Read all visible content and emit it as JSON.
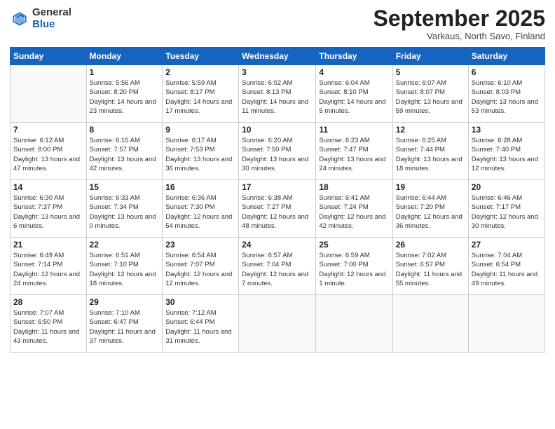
{
  "header": {
    "logo_general": "General",
    "logo_blue": "Blue",
    "title": "September 2025",
    "location": "Varkaus, North Savo, Finland"
  },
  "days_of_week": [
    "Sunday",
    "Monday",
    "Tuesday",
    "Wednesday",
    "Thursday",
    "Friday",
    "Saturday"
  ],
  "weeks": [
    [
      {
        "day": "",
        "sunrise": "",
        "sunset": "",
        "daylight": ""
      },
      {
        "day": "1",
        "sunrise": "Sunrise: 5:56 AM",
        "sunset": "Sunset: 8:20 PM",
        "daylight": "Daylight: 14 hours and 23 minutes."
      },
      {
        "day": "2",
        "sunrise": "Sunrise: 5:59 AM",
        "sunset": "Sunset: 8:17 PM",
        "daylight": "Daylight: 14 hours and 17 minutes."
      },
      {
        "day": "3",
        "sunrise": "Sunrise: 6:02 AM",
        "sunset": "Sunset: 8:13 PM",
        "daylight": "Daylight: 14 hours and 11 minutes."
      },
      {
        "day": "4",
        "sunrise": "Sunrise: 6:04 AM",
        "sunset": "Sunset: 8:10 PM",
        "daylight": "Daylight: 14 hours and 5 minutes."
      },
      {
        "day": "5",
        "sunrise": "Sunrise: 6:07 AM",
        "sunset": "Sunset: 8:07 PM",
        "daylight": "Daylight: 13 hours and 59 minutes."
      },
      {
        "day": "6",
        "sunrise": "Sunrise: 6:10 AM",
        "sunset": "Sunset: 8:03 PM",
        "daylight": "Daylight: 13 hours and 53 minutes."
      }
    ],
    [
      {
        "day": "7",
        "sunrise": "Sunrise: 6:12 AM",
        "sunset": "Sunset: 8:00 PM",
        "daylight": "Daylight: 13 hours and 47 minutes."
      },
      {
        "day": "8",
        "sunrise": "Sunrise: 6:15 AM",
        "sunset": "Sunset: 7:57 PM",
        "daylight": "Daylight: 13 hours and 42 minutes."
      },
      {
        "day": "9",
        "sunrise": "Sunrise: 6:17 AM",
        "sunset": "Sunset: 7:53 PM",
        "daylight": "Daylight: 13 hours and 36 minutes."
      },
      {
        "day": "10",
        "sunrise": "Sunrise: 6:20 AM",
        "sunset": "Sunset: 7:50 PM",
        "daylight": "Daylight: 13 hours and 30 minutes."
      },
      {
        "day": "11",
        "sunrise": "Sunrise: 6:23 AM",
        "sunset": "Sunset: 7:47 PM",
        "daylight": "Daylight: 13 hours and 24 minutes."
      },
      {
        "day": "12",
        "sunrise": "Sunrise: 6:25 AM",
        "sunset": "Sunset: 7:44 PM",
        "daylight": "Daylight: 13 hours and 18 minutes."
      },
      {
        "day": "13",
        "sunrise": "Sunrise: 6:28 AM",
        "sunset": "Sunset: 7:40 PM",
        "daylight": "Daylight: 13 hours and 12 minutes."
      }
    ],
    [
      {
        "day": "14",
        "sunrise": "Sunrise: 6:30 AM",
        "sunset": "Sunset: 7:37 PM",
        "daylight": "Daylight: 13 hours and 6 minutes."
      },
      {
        "day": "15",
        "sunrise": "Sunrise: 6:33 AM",
        "sunset": "Sunset: 7:34 PM",
        "daylight": "Daylight: 13 hours and 0 minutes."
      },
      {
        "day": "16",
        "sunrise": "Sunrise: 6:36 AM",
        "sunset": "Sunset: 7:30 PM",
        "daylight": "Daylight: 12 hours and 54 minutes."
      },
      {
        "day": "17",
        "sunrise": "Sunrise: 6:38 AM",
        "sunset": "Sunset: 7:27 PM",
        "daylight": "Daylight: 12 hours and 48 minutes."
      },
      {
        "day": "18",
        "sunrise": "Sunrise: 6:41 AM",
        "sunset": "Sunset: 7:24 PM",
        "daylight": "Daylight: 12 hours and 42 minutes."
      },
      {
        "day": "19",
        "sunrise": "Sunrise: 6:44 AM",
        "sunset": "Sunset: 7:20 PM",
        "daylight": "Daylight: 12 hours and 36 minutes."
      },
      {
        "day": "20",
        "sunrise": "Sunrise: 6:46 AM",
        "sunset": "Sunset: 7:17 PM",
        "daylight": "Daylight: 12 hours and 30 minutes."
      }
    ],
    [
      {
        "day": "21",
        "sunrise": "Sunrise: 6:49 AM",
        "sunset": "Sunset: 7:14 PM",
        "daylight": "Daylight: 12 hours and 24 minutes."
      },
      {
        "day": "22",
        "sunrise": "Sunrise: 6:51 AM",
        "sunset": "Sunset: 7:10 PM",
        "daylight": "Daylight: 12 hours and 18 minutes."
      },
      {
        "day": "23",
        "sunrise": "Sunrise: 6:54 AM",
        "sunset": "Sunset: 7:07 PM",
        "daylight": "Daylight: 12 hours and 12 minutes."
      },
      {
        "day": "24",
        "sunrise": "Sunrise: 6:57 AM",
        "sunset": "Sunset: 7:04 PM",
        "daylight": "Daylight: 12 hours and 7 minutes."
      },
      {
        "day": "25",
        "sunrise": "Sunrise: 6:59 AM",
        "sunset": "Sunset: 7:00 PM",
        "daylight": "Daylight: 12 hours and 1 minute."
      },
      {
        "day": "26",
        "sunrise": "Sunrise: 7:02 AM",
        "sunset": "Sunset: 6:57 PM",
        "daylight": "Daylight: 11 hours and 55 minutes."
      },
      {
        "day": "27",
        "sunrise": "Sunrise: 7:04 AM",
        "sunset": "Sunset: 6:54 PM",
        "daylight": "Daylight: 11 hours and 49 minutes."
      }
    ],
    [
      {
        "day": "28",
        "sunrise": "Sunrise: 7:07 AM",
        "sunset": "Sunset: 6:50 PM",
        "daylight": "Daylight: 11 hours and 43 minutes."
      },
      {
        "day": "29",
        "sunrise": "Sunrise: 7:10 AM",
        "sunset": "Sunset: 6:47 PM",
        "daylight": "Daylight: 11 hours and 37 minutes."
      },
      {
        "day": "30",
        "sunrise": "Sunrise: 7:12 AM",
        "sunset": "Sunset: 6:44 PM",
        "daylight": "Daylight: 11 hours and 31 minutes."
      },
      {
        "day": "",
        "sunrise": "",
        "sunset": "",
        "daylight": ""
      },
      {
        "day": "",
        "sunrise": "",
        "sunset": "",
        "daylight": ""
      },
      {
        "day": "",
        "sunrise": "",
        "sunset": "",
        "daylight": ""
      },
      {
        "day": "",
        "sunrise": "",
        "sunset": "",
        "daylight": ""
      }
    ]
  ]
}
